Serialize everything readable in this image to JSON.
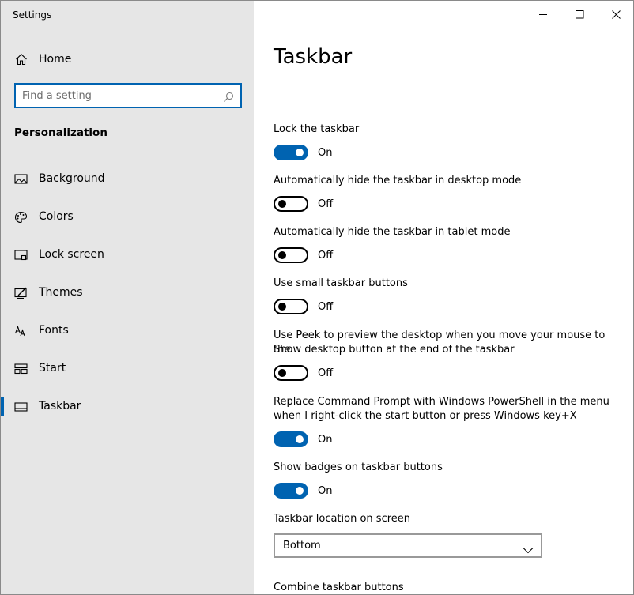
{
  "window": {
    "title": "Settings"
  },
  "sidebar": {
    "home_label": "Home",
    "search_placeholder": "Find a setting",
    "section_title": "Personalization",
    "items": [
      {
        "label": "Background",
        "icon": "picture-icon"
      },
      {
        "label": "Colors",
        "icon": "palette-icon"
      },
      {
        "label": "Lock screen",
        "icon": "lock-screen-icon"
      },
      {
        "label": "Themes",
        "icon": "themes-icon"
      },
      {
        "label": "Fonts",
        "icon": "fonts-icon"
      },
      {
        "label": "Start",
        "icon": "start-icon"
      },
      {
        "label": "Taskbar",
        "icon": "taskbar-icon",
        "active": true
      }
    ]
  },
  "main": {
    "title": "Taskbar",
    "settings": [
      {
        "label": "Lock the taskbar",
        "state": "On"
      },
      {
        "label": "Automatically hide the taskbar in desktop mode",
        "state": "Off"
      },
      {
        "label": "Automatically hide the taskbar in tablet mode",
        "state": "Off"
      },
      {
        "label": "Use small taskbar buttons",
        "state": "Off"
      },
      {
        "label_line1": "Use Peek to preview the desktop when you move your mouse to the",
        "label_line2": "Show desktop button at the end of the taskbar",
        "state": "Off"
      },
      {
        "label_line1": "Replace Command Prompt with Windows PowerShell in the menu",
        "label_line2": "when I right-click the start button or press Windows key+X",
        "state": "On"
      },
      {
        "label": "Show badges on taskbar buttons",
        "state": "On"
      }
    ],
    "location": {
      "label": "Taskbar location on screen",
      "value": "Bottom"
    },
    "combine_label": "Combine taskbar buttons"
  },
  "colors": {
    "accent": "#0063b1",
    "sidebar_bg": "#e6e6e6"
  }
}
